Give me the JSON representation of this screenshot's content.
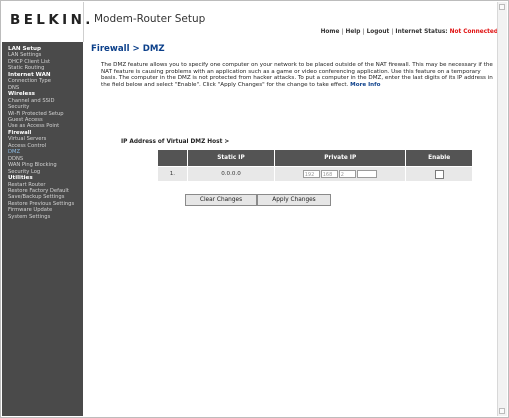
{
  "header": {
    "logo": "BELKIN.",
    "title": "Modem-Router Setup",
    "nav": {
      "home": "Home",
      "help": "Help",
      "logout": "Logout",
      "status_label": "Internet Status:",
      "status_value": "Not Connected",
      "status_color": "#e01010"
    }
  },
  "sidebar": {
    "items": [
      {
        "label": "LAN Setup",
        "kind": "section"
      },
      {
        "label": "LAN Settings",
        "kind": "item"
      },
      {
        "label": "DHCP Client List",
        "kind": "item"
      },
      {
        "label": "Static Routing",
        "kind": "item"
      },
      {
        "label": "Internet WAN",
        "kind": "section"
      },
      {
        "label": "Connection Type",
        "kind": "item"
      },
      {
        "label": "DNS",
        "kind": "item"
      },
      {
        "label": "Wireless",
        "kind": "section"
      },
      {
        "label": "Channel and SSID",
        "kind": "item"
      },
      {
        "label": "Security",
        "kind": "item"
      },
      {
        "label": "Wi-Fi Protected Setup",
        "kind": "item"
      },
      {
        "label": "Guest Access",
        "kind": "item"
      },
      {
        "label": "Use as Access Point",
        "kind": "item"
      },
      {
        "label": "Firewall",
        "kind": "active"
      },
      {
        "label": "Virtual Servers",
        "kind": "item"
      },
      {
        "label": "Access Control",
        "kind": "item"
      },
      {
        "label": "DMZ",
        "kind": "highlight"
      },
      {
        "label": "DDNS",
        "kind": "item"
      },
      {
        "label": "WAN Ping Blocking",
        "kind": "item"
      },
      {
        "label": "Security Log",
        "kind": "item"
      },
      {
        "label": "Utilities",
        "kind": "section"
      },
      {
        "label": "Restart Router",
        "kind": "item"
      },
      {
        "label": "Restore Factory Default",
        "kind": "item"
      },
      {
        "label": "Save/Backup Settings",
        "kind": "item"
      },
      {
        "label": "Restore Previous Settings",
        "kind": "item"
      },
      {
        "label": "Firmware Update",
        "kind": "item"
      },
      {
        "label": "System Settings",
        "kind": "item"
      }
    ]
  },
  "main": {
    "title": "Firewall > DMZ",
    "description": "The DMZ feature allows you to specify one computer on your network to be placed outside of the NAT firewall. This may be necessary if the NAT feature is causing problems with an application such as a game or video conferencing application. Use this feature on a temporary basis. The computer in the DMZ is not protected from hacker attacks. To put a computer in the DMZ, enter the last digits of its IP address in the field below and select \"Enable\". Click \"Apply Changes\" for the change to take effect.",
    "more_info": "More Info",
    "ip_label": "IP Address of Virtual DMZ Host >",
    "table": {
      "headers": [
        "",
        "Static IP",
        "Private IP",
        "Enable"
      ],
      "rows": [
        {
          "index": "1.",
          "static_ip": "0.0.0.0",
          "oct1": "192",
          "oct2": "168",
          "oct3": "2",
          "oct4": "",
          "enabled": false
        }
      ]
    },
    "buttons": {
      "clear": "Clear Changes",
      "apply": "Apply Changes"
    }
  }
}
